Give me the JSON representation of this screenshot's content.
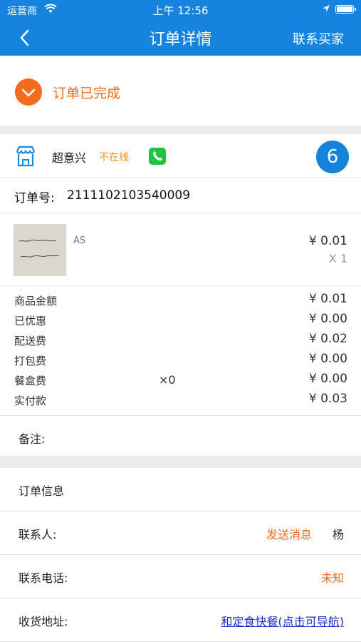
{
  "status_bar": {
    "carrier": "运营商",
    "time": "上午 12:56"
  },
  "nav": {
    "title": "订单详情",
    "right_label": "联系买家"
  },
  "order_status": {
    "text": "订单已完成",
    "color": "#f26c1d"
  },
  "shop": {
    "name": "超意兴",
    "online_status": "不在线",
    "badge_count": "6",
    "order_no_label": "订单号:",
    "order_no": "2111102103540009"
  },
  "item": {
    "name": "AS",
    "price": "¥ 0.01",
    "qty": "X 1"
  },
  "fees": [
    {
      "label": "商品金额",
      "mid": "",
      "value": "¥ 0.01"
    },
    {
      "label": "已优惠",
      "mid": "",
      "value": "¥ 0.00"
    },
    {
      "label": "配送费",
      "mid": "",
      "value": "¥ 0.02"
    },
    {
      "label": "打包费",
      "mid": "",
      "value": "¥ 0.00"
    },
    {
      "label": "餐盒费",
      "mid": "×0",
      "value": "¥ 0.00"
    },
    {
      "label": "实付款",
      "mid": "",
      "value": "¥ 0.03"
    }
  ],
  "remark_label": "备注:",
  "order_info": {
    "section_title": "订单信息",
    "contact_label": "联系人:",
    "send_message": "发送消息",
    "contact_name": "杨",
    "phone_label": "联系电话:",
    "phone_value": "未知",
    "address_label": "收货地址:",
    "address_value": "和定食快餐(点击可导航)"
  },
  "colors": {
    "primary": "#1684df",
    "accent": "#f26c1d",
    "offline": "#f29215",
    "phone": "#20c443"
  }
}
